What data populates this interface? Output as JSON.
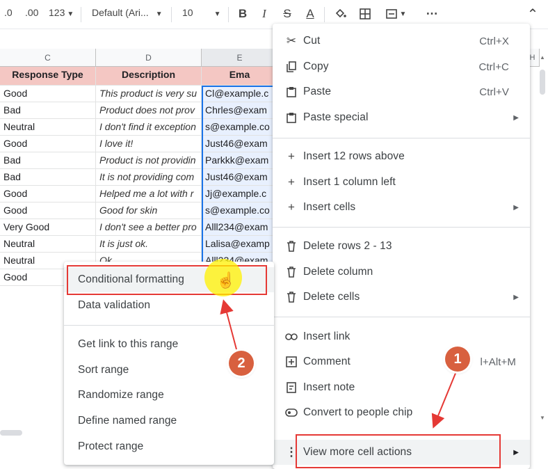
{
  "toolbar": {
    "decimal_decrease": ".0",
    "decimal_increase": ".00",
    "number_format": "123",
    "font_family": "Default (Ari...",
    "font_size": "10",
    "bold": "B",
    "italic": "I",
    "strikethrough": "S",
    "text_color": "A",
    "more": "⋯",
    "collapse": "⌃"
  },
  "sheet": {
    "columns": [
      "C",
      "D",
      "E",
      "H"
    ],
    "headers": [
      "Response Type",
      "Description",
      "Ema"
    ],
    "rows": [
      {
        "type": "Good",
        "desc": "This product is very su",
        "email": "Cl@example.c"
      },
      {
        "type": "Bad",
        "desc": "Product does not prov",
        "email": "Chrles@exam"
      },
      {
        "type": "Neutral",
        "desc": "I don't find it exception",
        "email": "s@example.co"
      },
      {
        "type": "Good",
        "desc": "I love it!",
        "email": "Just46@exam"
      },
      {
        "type": "Bad",
        "desc": "Product is not providin",
        "email": "Parkkk@exam"
      },
      {
        "type": "Bad",
        "desc": "It is not providing com",
        "email": "Just46@exam"
      },
      {
        "type": "Good",
        "desc": "Helped me a lot with r",
        "email": "Jj@example.c"
      },
      {
        "type": "Good",
        "desc": "Good for skin",
        "email": "s@example.co"
      },
      {
        "type": "Very Good",
        "desc": "I don't see a better pro",
        "email": "Alll234@exam"
      },
      {
        "type": "Neutral",
        "desc": "It is just ok.",
        "email": "Lalisa@examp"
      },
      {
        "type": "Neutral",
        "desc": "Ok",
        "email": "Alll234@exam"
      },
      {
        "type": "Good",
        "desc": "",
        "email": ""
      }
    ]
  },
  "context_menu": {
    "cut": {
      "label": "Cut",
      "shortcut": "Ctrl+X"
    },
    "copy": {
      "label": "Copy",
      "shortcut": "Ctrl+C"
    },
    "paste": {
      "label": "Paste",
      "shortcut": "Ctrl+V"
    },
    "paste_special": {
      "label": "Paste special"
    },
    "insert_rows": {
      "label": "Insert 12 rows above"
    },
    "insert_column": {
      "label": "Insert 1 column left"
    },
    "insert_cells": {
      "label": "Insert cells"
    },
    "delete_rows": {
      "label": "Delete rows 2 - 13"
    },
    "delete_column": {
      "label": "Delete column"
    },
    "delete_cells": {
      "label": "Delete cells"
    },
    "insert_link": {
      "label": "Insert link"
    },
    "comment": {
      "label": "Comment",
      "shortcut": "l+Alt+M"
    },
    "insert_note": {
      "label": "Insert note"
    },
    "people_chip": {
      "label": "Convert to people chip"
    },
    "more_actions": {
      "label": "View more cell actions"
    }
  },
  "submenu": {
    "items": [
      "Conditional formatting",
      "Data validation",
      "Get link to this range",
      "Sort range",
      "Randomize range",
      "Define named range",
      "Protect range"
    ]
  },
  "annotations": {
    "badge_1": "1",
    "badge_2": "2",
    "highlight_color": "#e53935",
    "badge_color": "#d8603f"
  }
}
